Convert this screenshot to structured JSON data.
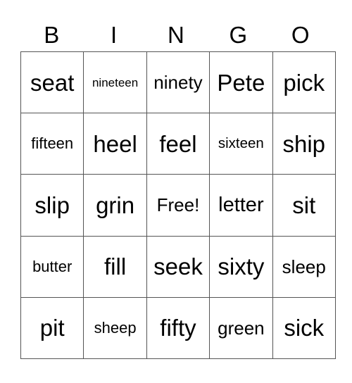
{
  "header": {
    "letters": [
      "B",
      "I",
      "N",
      "G",
      "O"
    ]
  },
  "card": {
    "rows": [
      [
        "seat",
        "nineteen",
        "ninety",
        "Pete",
        "pick"
      ],
      [
        "fifteen",
        "heel",
        "feel",
        "sixteen",
        "ship"
      ],
      [
        "slip",
        "grin",
        "Free!",
        "letter",
        "sit"
      ],
      [
        "butter",
        "fill",
        "seek",
        "sixty",
        "sleep"
      ],
      [
        "pit",
        "sheep",
        "fifty",
        "green",
        "sick"
      ]
    ]
  }
}
